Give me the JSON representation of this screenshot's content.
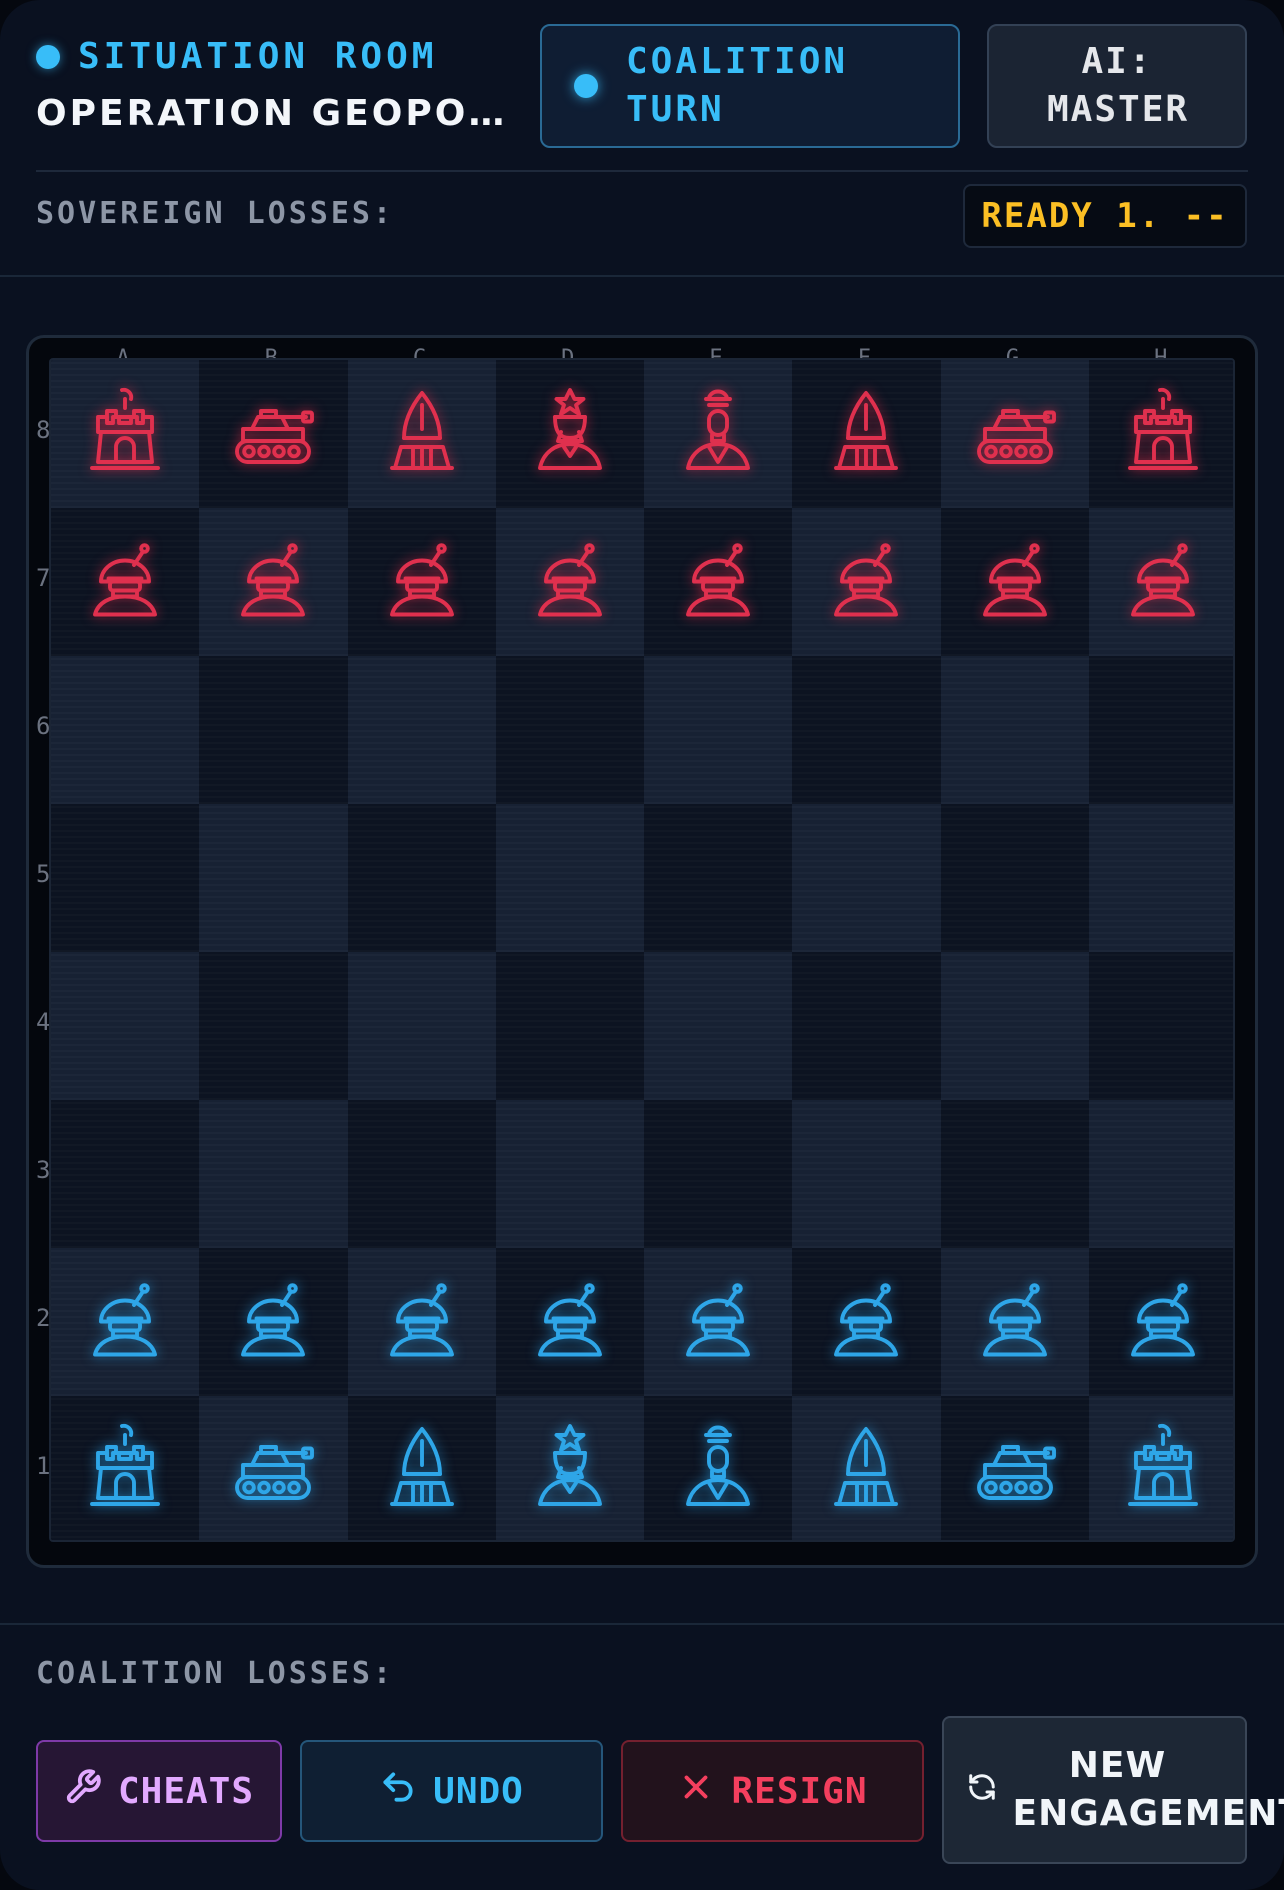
{
  "header": {
    "room_label": "SITUATION ROOM",
    "operation_title": "OPERATION GEOPOLITI…",
    "turn_label": "COALITION TURN",
    "ai_label": "AI: MASTER",
    "sovereign_losses_label": "SOVEREIGN LOSSES:",
    "ready_label": "READY 1. --"
  },
  "board": {
    "files": [
      "A",
      "B",
      "C",
      "D",
      "E",
      "F",
      "G",
      "H"
    ],
    "ranks": [
      "8",
      "7",
      "6",
      "5",
      "4",
      "3",
      "2",
      "1"
    ],
    "rows": [
      [
        "red:rook",
        "red:knight",
        "red:bishop",
        "red:queen",
        "red:king",
        "red:bishop",
        "red:knight",
        "red:rook"
      ],
      [
        "red:pawn",
        "red:pawn",
        "red:pawn",
        "red:pawn",
        "red:pawn",
        "red:pawn",
        "red:pawn",
        "red:pawn"
      ],
      [
        "",
        "",
        "",
        "",
        "",
        "",
        "",
        ""
      ],
      [
        "",
        "",
        "",
        "",
        "",
        "",
        "",
        ""
      ],
      [
        "",
        "",
        "",
        "",
        "",
        "",
        "",
        ""
      ],
      [
        "",
        "",
        "",
        "",
        "",
        "",
        "",
        ""
      ],
      [
        "blue:pawn",
        "blue:pawn",
        "blue:pawn",
        "blue:pawn",
        "blue:pawn",
        "blue:pawn",
        "blue:pawn",
        "blue:pawn"
      ],
      [
        "blue:rook",
        "blue:knight",
        "blue:bishop",
        "blue:queen",
        "blue:king",
        "blue:bishop",
        "blue:knight",
        "blue:rook"
      ]
    ],
    "colors": {
      "sovereign": "#e0304e",
      "coalition": "#2ea6e8"
    }
  },
  "footer": {
    "coalition_losses_label": "COALITION LOSSES:",
    "cheats_label": "CHEATS",
    "undo_label": "UNDO",
    "resign_label": "RESIGN",
    "new_engagement_label": "NEW ENGAGEMENT"
  },
  "icons": {
    "cheats": "wrench-icon",
    "undo": "undo-arrow-icon",
    "resign": "x-icon",
    "new_engagement": "refresh-icon"
  }
}
